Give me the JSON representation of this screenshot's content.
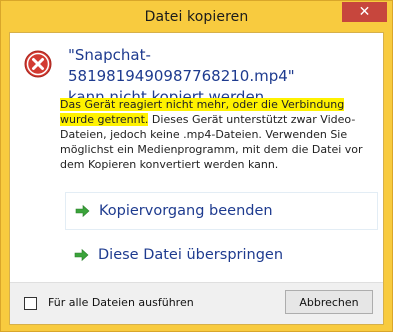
{
  "window": {
    "title": "Datei kopieren",
    "close_glyph": "✕"
  },
  "dialog": {
    "icon": "error-icon",
    "heading_line1": "\"Snapchat-5819819490987768210.mp4\"",
    "heading_line2": "kann nicht kopiert werden.",
    "description_highlighted": "Das Gerät reagiert nicht mehr, oder die Verbindung wurde getrennt.",
    "description_rest": " Dieses Gerät unterstützt zwar Video-Dateien, jedoch keine .mp4-Dateien. Verwenden Sie möglichst ein Medienprogramm, mit dem die Datei vor dem Kopieren konvertiert werden kann.",
    "options": [
      {
        "label": "Kopiervorgang beenden",
        "icon": "green-arrow-icon"
      },
      {
        "label": "Diese Datei überspringen",
        "icon": "green-arrow-icon"
      }
    ]
  },
  "footer": {
    "checkbox_label": "Für alle Dateien ausführen",
    "checkbox_checked": false,
    "cancel_label": "Abbrechen"
  },
  "colors": {
    "frame": "#f8cb3f",
    "close_button": "#c7463d",
    "heading": "#1e3b8f",
    "highlight": "#fff200",
    "arrow": "#3aa33a"
  }
}
